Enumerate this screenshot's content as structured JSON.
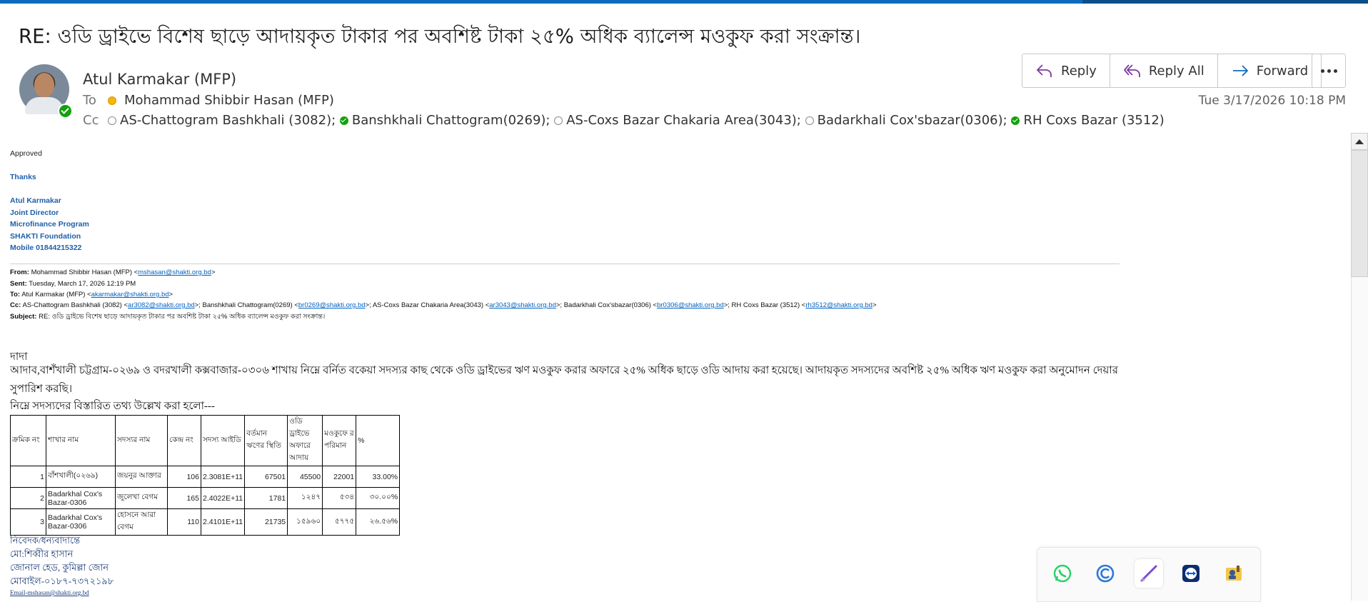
{
  "message": {
    "subject": "RE: ওডি ড্রাইভে বিশেষ ছাড়ে আদায়কৃত টাকার পর অবশিষ্ট টাকা ২৫% অধিক  ব্যালেন্স মওকুফ করা সংক্রান্ত।",
    "sender": "Atul  Karmakar (MFP)",
    "to_label": "To",
    "to": "Mohammad Shibbir Hasan (MFP)",
    "cc_label": "Cc",
    "cc": [
      {
        "name": "AS-Chattogram Bashkhali (3082);",
        "status": "off"
      },
      {
        "name": "Banshkhali  Chattogram(0269);",
        "status": "on"
      },
      {
        "name": "AS-Coxs Bazar Chakaria Area(3043);",
        "status": "off"
      },
      {
        "name": "Badarkhali Cox'sbazar(0306);",
        "status": "off"
      },
      {
        "name": "RH Coxs Bazar (3512)",
        "status": "on"
      }
    ],
    "timestamp": "Tue 3/17/2026 10:18 PM"
  },
  "actions": {
    "reply": "Reply",
    "reply_all": "Reply All",
    "forward": "Forward"
  },
  "body": {
    "approved": "Approved",
    "thanks": "Thanks",
    "signature": [
      "Atul Karmakar",
      "Joint Director",
      "Microfinance Program",
      "SHAKTI Foundation",
      "Mobile 01844215322"
    ],
    "quoted": {
      "from_label": "From:",
      "from_name": "Mohammad Shibbir Hasan (MFP) <",
      "from_email": "mshasan@shakti.org.bd",
      "sent_label": "Sent:",
      "sent": "Tuesday, March 17, 2026 12:19 PM",
      "to_label": "To:",
      "to_name": "Atul Karmakar (MFP) <",
      "to_email": "akarmakar@shakti.org.bd",
      "cc_label": "Cc:",
      "cc_1": "AS-Chattogram Bashkhali (3082) <",
      "cc_1_email": "ar3082@shakti.org.bd",
      "cc_2": ">; Banshkhali Chattogram(0269) <",
      "cc_2_email": "br0269@shakti.org.bd",
      "cc_3": ">; AS-Coxs Bazar Chakaria Area(3043) <",
      "cc_3_email": "ar3043@shakti.org.bd",
      "cc_4": ">; Badarkhali Cox'sbazar(0306) <",
      "cc_4_email": "br0306@shakti.org.bd",
      "cc_5": ">; RH Coxs Bazar (3512) <",
      "cc_5_email": "rh3512@shakti.org.bd",
      "subject_label": "Subject:",
      "subject": "RE: ওডি ড্রাইভে বিশেষ ছাড়ে আদায়কৃত টাকার পর অবশিষ্ট টাকা ২৫% অধিক ব্যালেন্স মওকুফ করা সংক্রান্ত।"
    },
    "greeting": "দাদা",
    "para1": "আদাব,বাশঁখালী চট্টগ্রাম-০২৬৯ ও বদরখালী কক্সবাজার-০৩০৬ শাখায় নিম্নে বর্নিত বকেয়া সদস্যর কাছ থেকে ওডি ড্রাইভের ঋণ মওকুফ করার অফারে ২৫% অধিক ছাড়ে ওডি আদায় করা হয়েছে। আদায়কৃত সদস্যদের অবশিষ্ট ২৫% অধিক ঋণ মওকুফ করা অনুমোদন দেয়ার",
    "para2": "সুপারিশ করছি।",
    "para3": "নিম্নে সদস্যদের বিস্তারিত তথ্য উল্লেখ করা হলো---",
    "table": {
      "headers": [
        "ক্রমিক নং",
        "শাখার নাম",
        "সদস্যর নাম",
        "কেন্দ্র নং",
        "সদস্য আইডি",
        "বর্তমান ঋণের স্থিতি",
        "ওডি ড্রাইভে অফারে আদায়",
        "মওকুফে র পরিমান",
        "%"
      ],
      "rows": [
        [
          "1",
          "বাঁশখালী(০২৬৯)",
          "জয়নুর আক্তার",
          "106",
          "2.3081E+11",
          "67501",
          "45500",
          "22001",
          "33.00%"
        ],
        [
          "2",
          "Badarkhal Cox's Bazar-0306",
          "জুলেখা বেগম",
          "165",
          "2.4022E+11",
          "1781",
          "১২৪৭",
          "৫৩৪",
          "৩০.০০%"
        ],
        [
          "3",
          "Badarkhal Cox's Bazar-0306",
          "হোসনে আরা বেগম",
          "110",
          "2.4101E+11",
          "21735",
          "১৫৯৬০",
          "৫৭৭৫",
          "২৬.৫৬%"
        ]
      ]
    },
    "closing": [
      "নিবেদক/ধন্যবাদান্তে",
      "মো:শিব্বীর হাসান",
      "জোনাল হেড, কুমিল্লা জোন",
      "মোবাইল-০১৮৭-৭৩৭২১৯৮"
    ],
    "closing_email": "Email-mshasan@shakti.org.bd"
  },
  "tray": [
    "whatsapp-icon",
    "c-app-icon",
    "pen-icon",
    "teamviewer-icon",
    "user-badge-icon"
  ],
  "colors": {
    "accent": "#0f6cbd",
    "link": "#0563c1",
    "signature": "#1f5fa8",
    "reply_icon": "#7b3a9c",
    "forward_icon": "#0f6cbd"
  }
}
